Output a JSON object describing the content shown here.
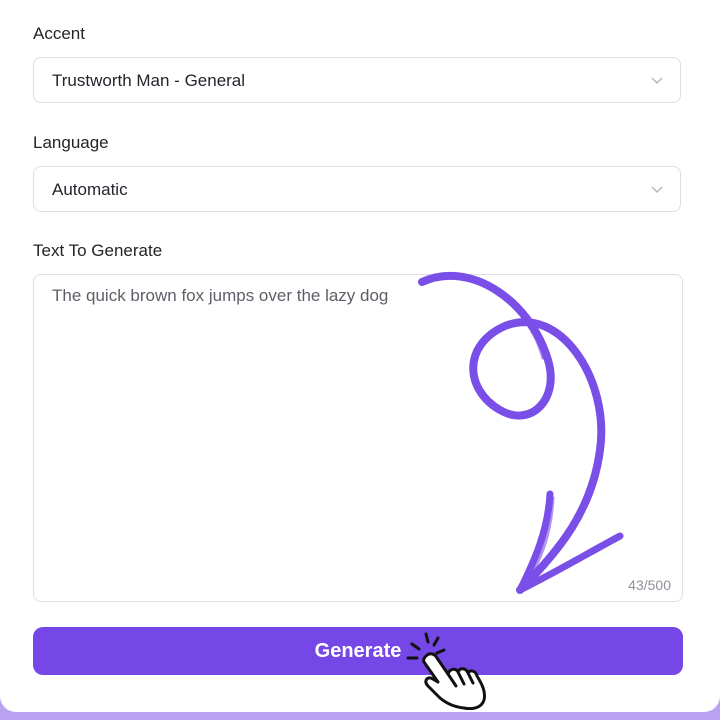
{
  "form": {
    "accent": {
      "label": "Accent",
      "value": "Trustworth Man - General"
    },
    "language": {
      "label": "Language",
      "value": "Automatic"
    },
    "text": {
      "label": "Text To Generate",
      "value": "The quick brown fox jumps over the lazy dog",
      "counter": "43/500"
    },
    "generate_label": "Generate"
  },
  "colors": {
    "accent": "#7447e6",
    "arrow": "#7a4fe8",
    "page_bg": "#b9a3f0"
  },
  "icons": {
    "select_chevron": "chevron-down-icon",
    "annotation_arrow": "curly-arrow-icon",
    "pointer_hand": "click-hand-icon"
  }
}
